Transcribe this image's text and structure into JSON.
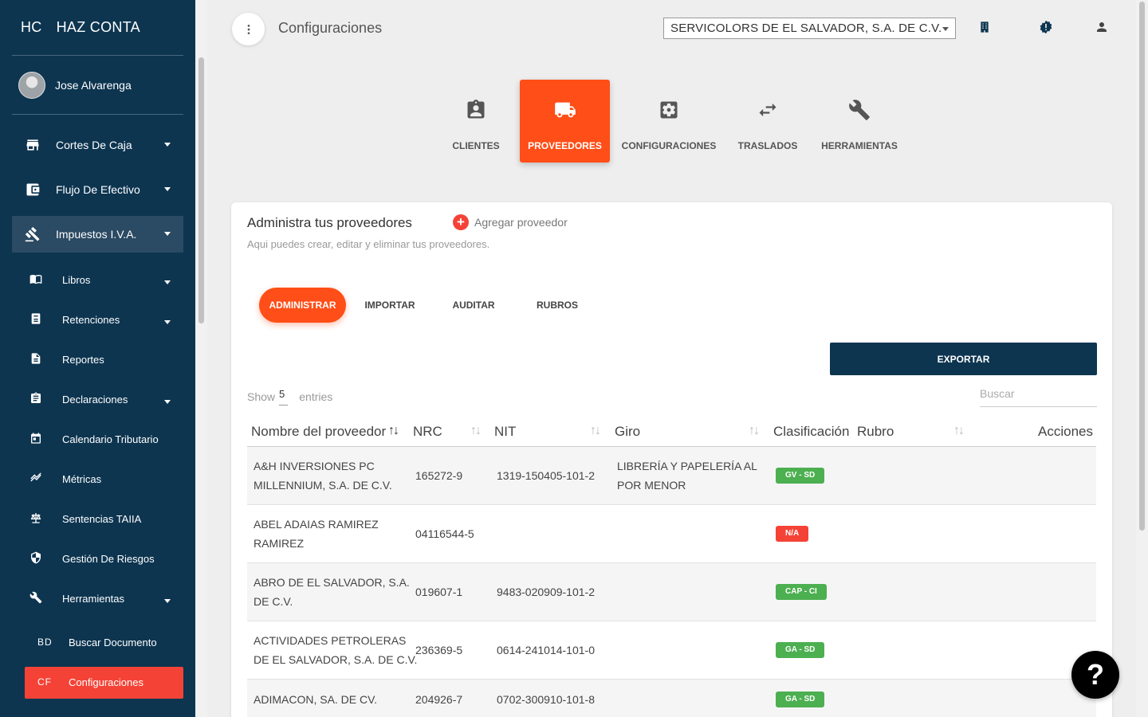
{
  "brand": {
    "abbr": "HC",
    "name": "HAZ CONTA"
  },
  "user": {
    "name": "Jose Alvarenga"
  },
  "sidebar": {
    "main": [
      {
        "label": "Cortes De Caja",
        "icon": "store-icon"
      },
      {
        "label": "Flujo De Efectivo",
        "icon": "wallet-icon"
      },
      {
        "label": "Impuestos I.V.A.",
        "icon": "gavel-icon",
        "active": true
      }
    ],
    "sub": [
      {
        "label": "Libros",
        "icon": "book-icon",
        "caret": true
      },
      {
        "label": "Retenciones",
        "icon": "receipt-icon",
        "caret": true
      },
      {
        "label": "Reportes",
        "icon": "document-icon",
        "caret": false
      },
      {
        "label": "Declaraciones",
        "icon": "clipboard-icon",
        "caret": true
      },
      {
        "label": "Calendario Tributario",
        "icon": "calendar-icon",
        "caret": false
      },
      {
        "label": "Métricas",
        "icon": "trend-icon",
        "caret": false
      },
      {
        "label": "Sentencias TAIIA",
        "icon": "scale-icon",
        "caret": false
      },
      {
        "label": "Gestión De Riesgos",
        "icon": "shield-icon",
        "caret": false
      },
      {
        "label": "Herramientas",
        "icon": "wrench-icon",
        "caret": true
      }
    ],
    "abbr_items": [
      {
        "abbr": "BD",
        "label": "Buscar Documento"
      },
      {
        "abbr": "CF",
        "label": "Configuraciones",
        "active": true
      }
    ]
  },
  "header": {
    "title": "Configuraciones",
    "company": "SERVICOLORS DE EL SALVADOR, S.A. DE C.V."
  },
  "categories": [
    {
      "label": "CLIENTES",
      "icon": "contact-badge-icon"
    },
    {
      "label": "PROVEEDORES",
      "icon": "truck-icon",
      "active": true
    },
    {
      "label": "CONFIGURACIONES",
      "icon": "settings-icon"
    },
    {
      "label": "TRASLADOS",
      "icon": "swap-icon"
    },
    {
      "label": "HERRAMIENTAS",
      "icon": "wrench-icon"
    }
  ],
  "card": {
    "title": "Administra tus proveedores",
    "add_label": "Agregar proveedor",
    "subtitle": "Aqui puedes crear, editar y eliminar tus proveedores.",
    "tabs": [
      "ADMINISTRAR",
      "IMPORTAR",
      "AUDITAR",
      "RUBROS"
    ],
    "export_label": "EXPORTAR",
    "show_label": "Show",
    "show_value": "5",
    "entries_label": "entries",
    "search_placeholder": "Buscar"
  },
  "table": {
    "headers": [
      "Nombre del proveedor",
      "NRC",
      "NIT",
      "Giro",
      "Clasificación",
      "Rubro",
      "Acciones"
    ],
    "rows": [
      {
        "name": [
          "A&H INVERSIONES PC",
          "MILLENNIUM, S.A. DE C.V."
        ],
        "nrc": "165272-9",
        "nit": "1319-150405-101-2",
        "giro": [
          "LIBRERÍA Y PAPELERÍA AL",
          "POR MENOR"
        ],
        "clasificacion": "GV - SD",
        "color": "#4caf50"
      },
      {
        "name": [
          "ABEL ADAIAS RAMIREZ",
          "RAMIREZ"
        ],
        "nrc": "04116544-5",
        "nit": "",
        "giro": [
          "",
          ""
        ],
        "clasificacion": "N/A",
        "color": "#f44336"
      },
      {
        "name": [
          "ABRO DE EL SALVADOR, S.A.",
          "DE C.V."
        ],
        "nrc": "019607-1",
        "nit": "9483-020909-101-2",
        "giro": [
          "",
          ""
        ],
        "clasificacion": "CAP - CI",
        "color": "#4caf50"
      },
      {
        "name": [
          "ACTIVIDADES PETROLERAS",
          "DE EL SALVADOR, S.A. DE C.V."
        ],
        "nrc": "236369-5",
        "nit": "0614-241014-101-0",
        "giro": [
          "",
          ""
        ],
        "clasificacion": "GA - SD",
        "color": "#4caf50"
      },
      {
        "name": [
          "ADIMACON, SA. DE CV.",
          ""
        ],
        "nrc": "204926-7",
        "nit": "0702-300910-101-8",
        "giro": [
          "",
          ""
        ],
        "clasificacion": "GA - SD",
        "color": "#4caf50"
      }
    ]
  },
  "help_label": "?"
}
